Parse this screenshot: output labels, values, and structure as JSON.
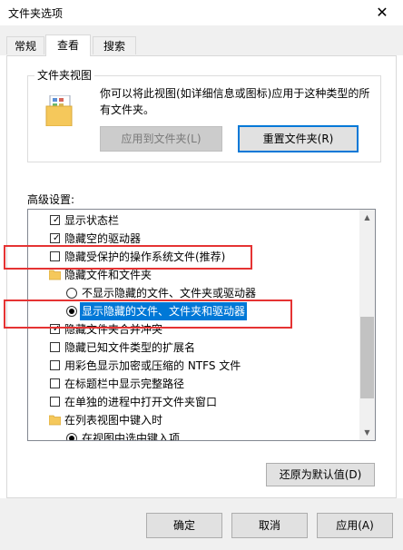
{
  "window": {
    "title": "文件夹选项",
    "close_glyph": "✕"
  },
  "tabs": [
    {
      "label": "常规"
    },
    {
      "label": "查看"
    },
    {
      "label": "搜索"
    }
  ],
  "folder_view": {
    "caption": "文件夹视图",
    "description": "你可以将此视图(如详细信息或图标)应用于这种类型的所有文件夹。",
    "apply_button": "应用到文件夹(L)",
    "reset_button": "重置文件夹(R)"
  },
  "advanced": {
    "label": "高级设置:",
    "items": [
      {
        "type": "checkbox",
        "label": "显示状态栏",
        "checked": true
      },
      {
        "type": "checkbox",
        "label": "隐藏空的驱动器",
        "checked": true
      },
      {
        "type": "checkbox",
        "label": "隐藏受保护的操作系统文件(推荐)",
        "checked": false
      },
      {
        "type": "folder",
        "label": "隐藏文件和文件夹"
      },
      {
        "type": "radio",
        "label": "不显示隐藏的文件、文件夹或驱动器",
        "checked": false
      },
      {
        "type": "radio",
        "label": "显示隐藏的文件、文件夹和驱动器",
        "checked": true,
        "selected": true
      },
      {
        "type": "checkbox",
        "label": "隐藏文件夹合并冲突",
        "checked": true
      },
      {
        "type": "checkbox",
        "label": "隐藏已知文件类型的扩展名",
        "checked": false
      },
      {
        "type": "checkbox",
        "label": "用彩色显示加密或压缩的 NTFS 文件",
        "checked": false
      },
      {
        "type": "checkbox",
        "label": "在标题栏中显示完整路径",
        "checked": false
      },
      {
        "type": "checkbox",
        "label": "在单独的进程中打开文件夹窗口",
        "checked": false
      },
      {
        "type": "folder",
        "label": "在列表视图中键入时"
      },
      {
        "type": "radio",
        "label": "在视图中选中键入项",
        "checked": true
      }
    ],
    "restore_button": "还原为默认值(D)"
  },
  "footer": {
    "ok": "确定",
    "cancel": "取消",
    "apply": "应用(A)"
  },
  "colors": {
    "accent": "#0078d7",
    "highlight_box": "#e53333",
    "folder": "#f5c85b"
  },
  "icons": {
    "checkmark": "✓",
    "scroll_up": "▲",
    "scroll_down": "▼"
  }
}
